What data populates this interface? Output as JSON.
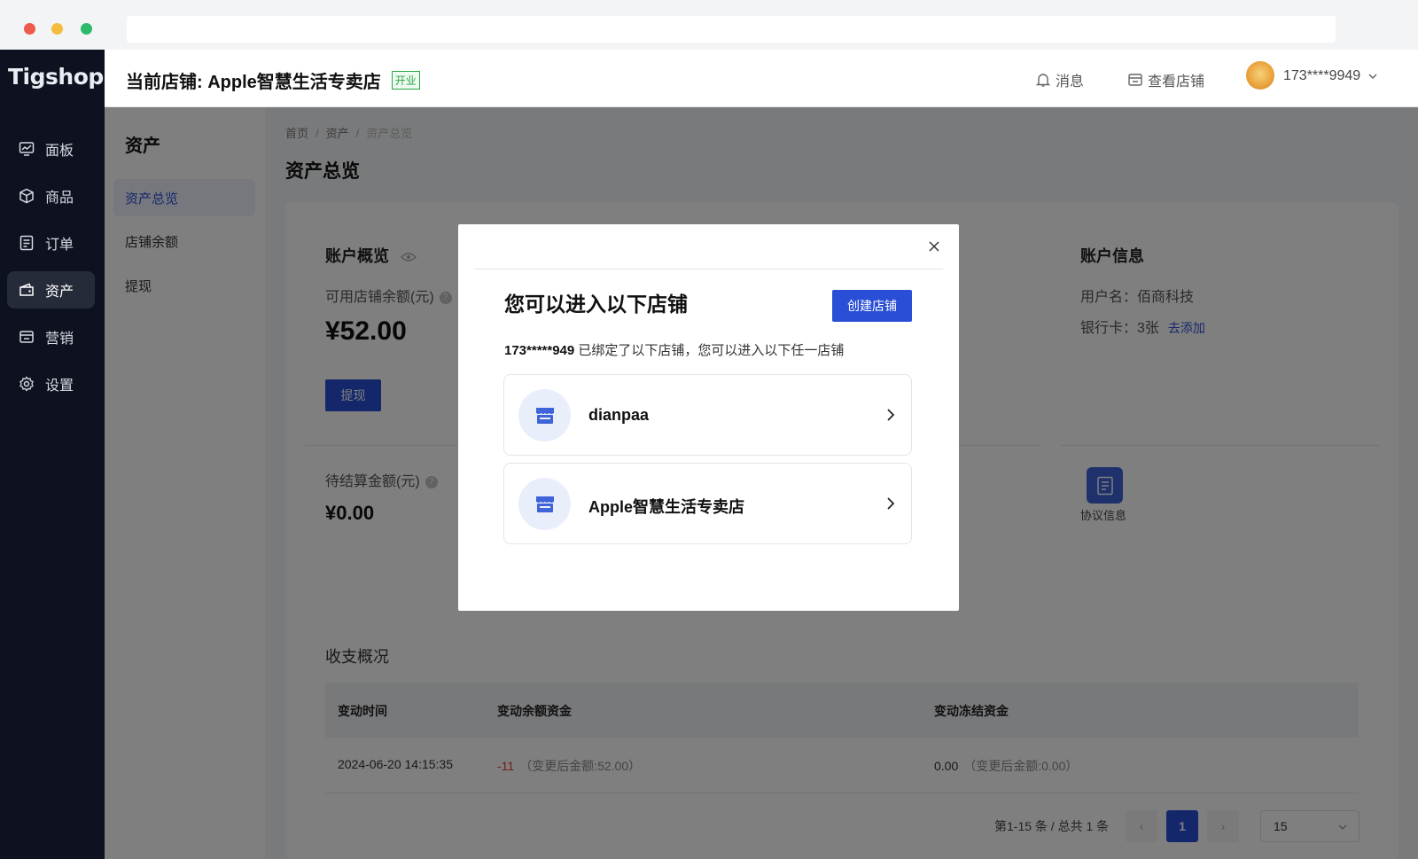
{
  "app": {
    "logo": "Tigshop",
    "nav": [
      {
        "label": "面板",
        "icon": "dashboard-icon"
      },
      {
        "label": "商品",
        "icon": "box-icon"
      },
      {
        "label": "订单",
        "icon": "order-icon"
      },
      {
        "label": "资产",
        "icon": "wallet-icon",
        "active": true
      },
      {
        "label": "营销",
        "icon": "marketing-icon"
      },
      {
        "label": "设置",
        "icon": "gear-icon"
      }
    ]
  },
  "header": {
    "store_label": "当前店铺: Apple智慧生活专卖店",
    "badge": "开业",
    "messages": "消息",
    "view_store": "查看店铺",
    "user": "173****9949"
  },
  "subnav": {
    "title": "资产",
    "items": [
      {
        "label": "资产总览",
        "active": true
      },
      {
        "label": "店铺余额"
      },
      {
        "label": "提现"
      }
    ]
  },
  "breadcrumb": [
    "首页",
    "资产",
    "资产总览"
  ],
  "page_title": "资产总览",
  "overview": {
    "title": "账户概览",
    "available_label": "可用店铺余额(元)",
    "available_value": "¥52.00",
    "withdraw_btn": "提现",
    "pending_label": "待结算金额(元)",
    "pending_value": "¥0.00"
  },
  "account_info": {
    "title": "账户信息",
    "username": "用户名：佰商科技",
    "bank_cards": "银行卡：3张",
    "add_link": "去添加",
    "agreement": "协议信息"
  },
  "ledger": {
    "title": "收支概况",
    "columns": [
      "变动时间",
      "变动余额资金",
      "变动冻结资金"
    ],
    "rows": [
      {
        "time": "2024-06-20 14:15:35",
        "balance": "-11",
        "balance_note": "（变更后金额:52.00）",
        "frozen": "0.00",
        "frozen_note": "（变更后金额:0.00）"
      }
    ],
    "pagination": {
      "summary": "第1-15 条 / 总共 1 条",
      "current": "1",
      "page_size": "15"
    }
  },
  "modal": {
    "title": "您可以进入以下店铺",
    "create_btn": "创建店铺",
    "desc_account": "173*****949",
    "desc_text": " 已绑定了以下店铺，您可以进入以下任一店铺",
    "shops": [
      {
        "name": "dianpaa"
      },
      {
        "name": "Apple智慧生活专卖店"
      }
    ]
  },
  "colors": {
    "accent": "#2a4fd6",
    "sidebar": "#0d1120",
    "negative": "#e23c3c",
    "open_badge": "#28a745"
  }
}
